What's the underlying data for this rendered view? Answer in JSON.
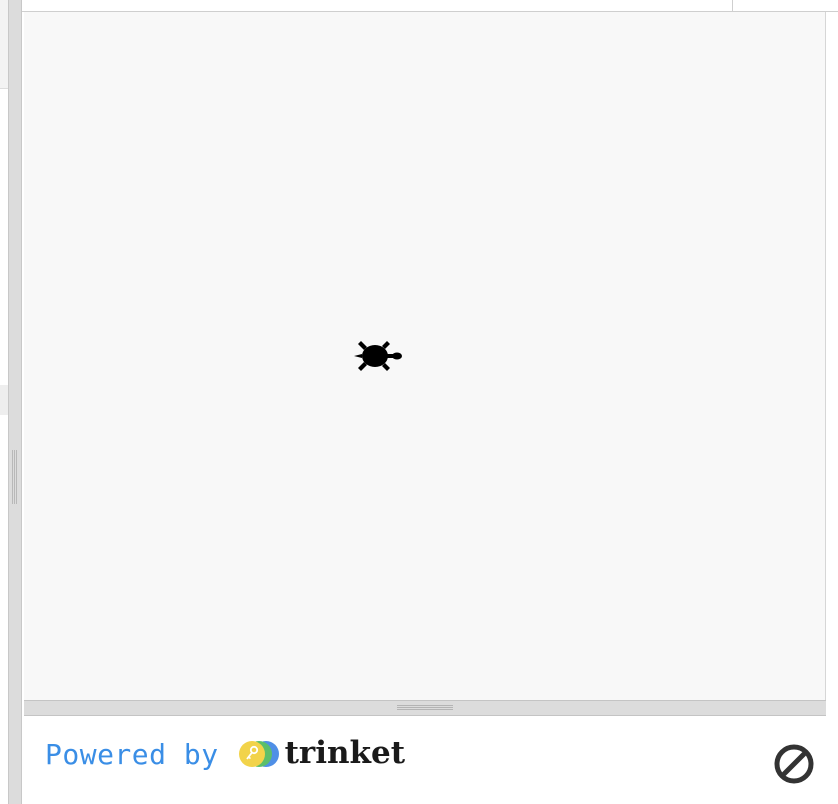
{
  "footer": {
    "powered_by": "Powered by",
    "brand": "trinket"
  },
  "icons": {
    "turtle": "turtle-icon",
    "trinket_logo": "trinket-logo-icon",
    "stop": "stop-icon"
  },
  "colors": {
    "canvas_bg": "#f8f8f8",
    "link_blue": "#3a8ee6",
    "brand_text": "#1a1a1a",
    "logo_yellow": "#f2d34a",
    "logo_green": "#5cbf6a",
    "logo_blue": "#4f8fe6"
  }
}
